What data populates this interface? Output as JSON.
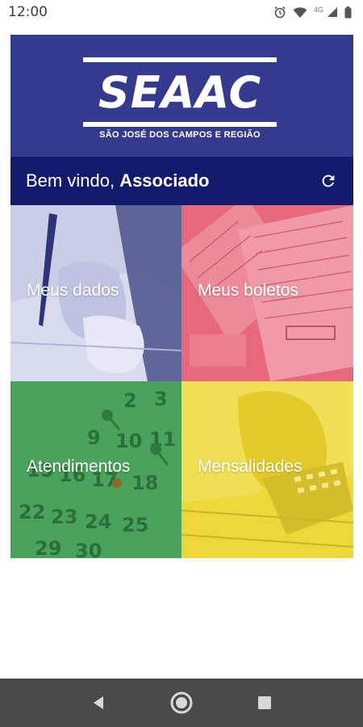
{
  "status_bar": {
    "time": "12:00",
    "network": "4G",
    "icons": [
      "alarm-icon",
      "wifi-icon",
      "signal-icon",
      "battery-icon"
    ]
  },
  "logo": {
    "wordmark": "SEAAC",
    "subtitle": "SÃO JOSÉ DOS CAMPOS E REGIÃO"
  },
  "welcome": {
    "prefix": "Bem vindo,",
    "user": "Associado",
    "refresh_icon": "refresh-icon"
  },
  "tiles": [
    {
      "label": "Meus dados",
      "color": "#c9cde6"
    },
    {
      "label": "Meus boletos",
      "color": "#e5687d"
    },
    {
      "label": "Atendimentos",
      "color": "#3f9a54"
    },
    {
      "label": "Mensalidades",
      "color": "#ecd83a"
    }
  ],
  "colors": {
    "header": "#353a8e",
    "welcome_bar": "#151b6b",
    "nav_bar": "#4a4a4a"
  },
  "nav_bar": {
    "icons": [
      "back-icon",
      "home-icon",
      "recents-icon"
    ]
  }
}
